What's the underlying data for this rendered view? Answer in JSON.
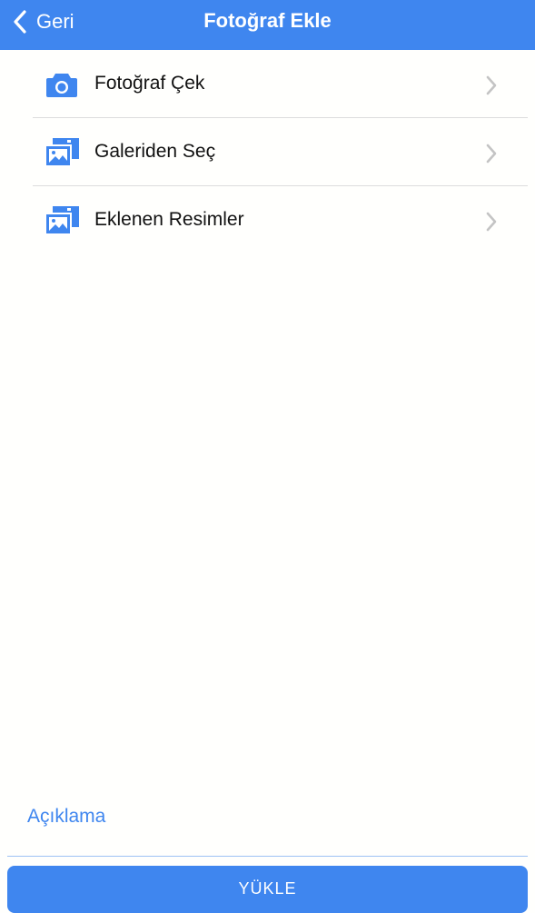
{
  "navbar": {
    "back_label": "Geri",
    "title": "Fotoğraf Ekle",
    "background": "#3f86ef"
  },
  "menu": {
    "items": [
      {
        "label": "Fotoğraf Çek",
        "icon": "camera-icon"
      },
      {
        "label": "Galeriden Seç",
        "icon": "gallery-icon"
      },
      {
        "label": "Eklenen Resimler",
        "icon": "gallery-icon"
      }
    ]
  },
  "description": {
    "placeholder": "Açıklama"
  },
  "upload_button": {
    "label": "YÜKLE"
  },
  "colors": {
    "accent": "#3f86ef",
    "background": "#fffffd",
    "chevron": "#c4c4c4"
  }
}
